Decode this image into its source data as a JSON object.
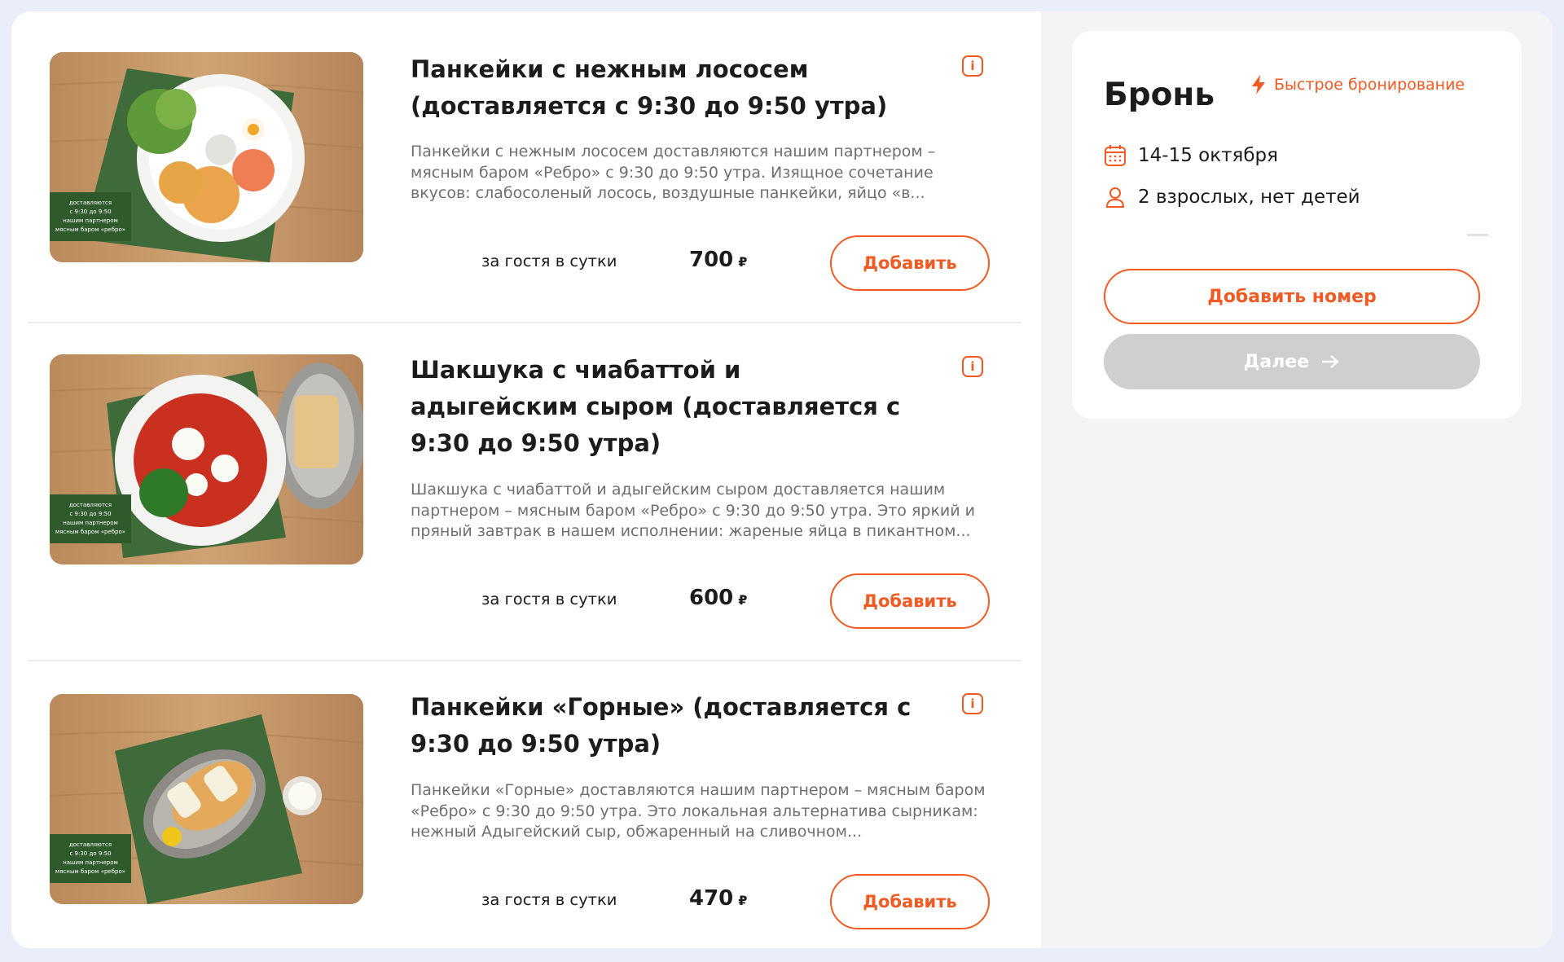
{
  "colors": {
    "accent": "#f15a22",
    "panel": "#ffffff",
    "side": "#f4f4f6",
    "page_bg": "#eaeefa"
  },
  "items": [
    {
      "title": "Панкейки с нежным лососем (доставляется с 9:30 до 9:50 утра)",
      "description": "Панкейки с нежным лососем доставляются нашим партнером – мясным баром «Ребро» с 9:30 до 9:50 утра. Изящное сочетание вкусов: слабосоленый лосось, воздушные панкейки, яйцо «в...",
      "per_guest": "за гостя в сутки",
      "price": "700",
      "currency": "₽",
      "add_label": "Добавить",
      "image_caption": "доставляются с 9:30 до 9:50 нашим партнером мясным баром «ребро»",
      "image_icon": "pancakes-salmon-photo"
    },
    {
      "title": "Шакшука с чиабаттой и адыгейским сыром (доставляется с 9:30 до 9:50 утра)",
      "description": "Шакшука с чиабаттой и адыгейским сыром доставляется нашим партнером – мясным баром «Ребро» с 9:30 до 9:50 утра. Это яркий и пряный завтрак в нашем исполнении: жареные яйца в пикантном...",
      "per_guest": "за гостя в сутки",
      "price": "600",
      "currency": "₽",
      "add_label": "Добавить",
      "image_caption": "доставляются с 9:30 до 9:50 нашим партнером мясным баром «ребро»",
      "image_icon": "shakshuka-photo"
    },
    {
      "title": "Панкейки «Горные» (доставляется с 9:30 до 9:50 утра)",
      "description": "Панкейки «Горные» доставляются нашим партнером – мясным баром «Ребро» с 9:30 до 9:50 утра. Это локальная альтернатива сырникам: нежный Адыгейский сыр, обжаренный на сливочном...",
      "per_guest": "за гостя в сутки",
      "price": "470",
      "currency": "₽",
      "add_label": "Добавить",
      "image_caption": "доставляются с 9:30 до 9:50 нашим партнером мясным баром «ребро»",
      "image_icon": "pancakes-gornye-photo"
    }
  ],
  "booking": {
    "title": "Бронь",
    "quick_label": "Быстрое бронирование",
    "dates": "14-15 октября",
    "guests": "2 взрослых, нет детей",
    "add_room_label": "Добавить номер",
    "next_label": "Далее"
  }
}
